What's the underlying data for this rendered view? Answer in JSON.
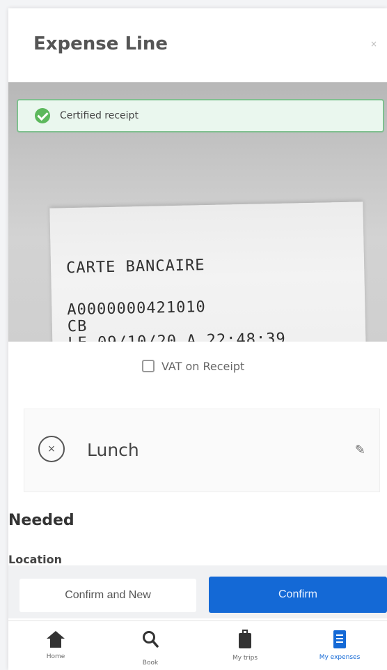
{
  "header": {
    "title": "Expense Line",
    "close_label": "×"
  },
  "receipt": {
    "certified_label": "Certified receipt",
    "lines": [
      "CARTE BANCAIRE",
      "A0000000421010",
      "CB",
      "LE 09/10/20 A 22:48:39"
    ]
  },
  "vat": {
    "label": "VAT on Receipt",
    "checked": false
  },
  "category": {
    "icon_text": "×",
    "label": "Lunch",
    "edit_glyph": "✎"
  },
  "sections": {
    "needed": "Needed",
    "location": "Location"
  },
  "actions": {
    "secondary": "Confirm and New",
    "primary": "Confirm"
  },
  "tabbar": {
    "items": [
      {
        "label": "Home",
        "icon": "home-icon"
      },
      {
        "label": "Book",
        "icon": "search-icon"
      },
      {
        "label": "My trips",
        "icon": "luggage-icon"
      },
      {
        "label": "My expenses",
        "icon": "receipt-icon",
        "active": true
      }
    ]
  },
  "colors": {
    "primary": "#1469d6",
    "success": "#5cb85c",
    "banner_border": "#7fc08f"
  }
}
